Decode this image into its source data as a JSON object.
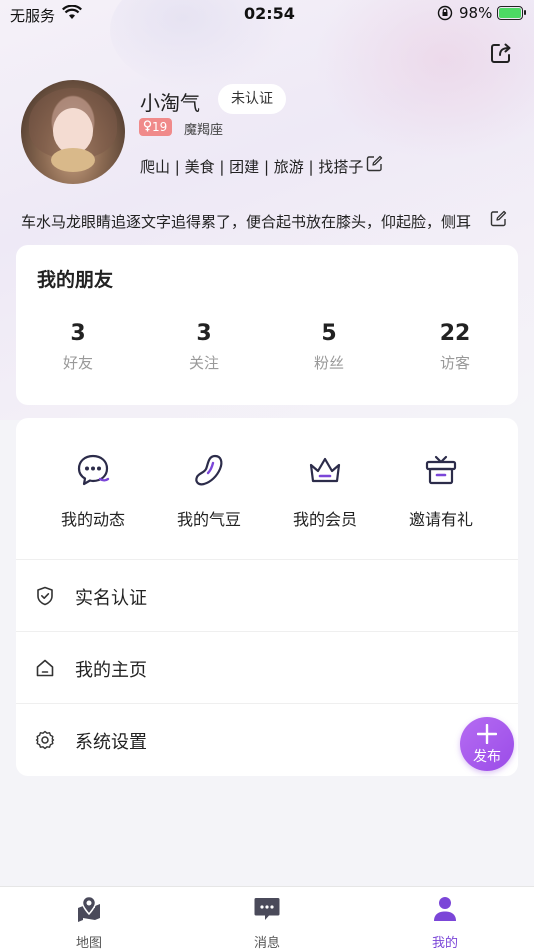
{
  "status_bar": {
    "carrier": "无服务",
    "time": "02:54",
    "battery": "98%"
  },
  "profile": {
    "nickname": "小淘气",
    "verify_status": "未认证",
    "age": "19",
    "zodiac": "魔羯座",
    "tags": "爬山 | 美食 | 团建 | 旅游 | 找搭子",
    "bio": "车水马龙眼睛追逐文字追得累了，便合起书放在膝头，仰起脸，侧耳"
  },
  "friends": {
    "title": "我的朋友",
    "stats": [
      {
        "value": "3",
        "label": "好友"
      },
      {
        "value": "3",
        "label": "关注"
      },
      {
        "value": "5",
        "label": "粉丝"
      },
      {
        "value": "22",
        "label": "访客"
      }
    ]
  },
  "features": [
    {
      "label": "我的动态",
      "icon": "chat-bubble-icon"
    },
    {
      "label": "我的气豆",
      "icon": "bean-icon"
    },
    {
      "label": "我的会员",
      "icon": "crown-icon"
    },
    {
      "label": "邀请有礼",
      "icon": "gift-icon"
    }
  ],
  "menu": [
    {
      "label": "实名认证",
      "icon": "shield-check-icon"
    },
    {
      "label": "我的主页",
      "icon": "home-icon"
    },
    {
      "label": "系统设置",
      "icon": "gear-icon"
    }
  ],
  "fab": {
    "label": "发布"
  },
  "tabs": [
    {
      "label": "地图",
      "icon": "map-pin-icon"
    },
    {
      "label": "消息",
      "icon": "message-icon"
    },
    {
      "label": "我的",
      "icon": "user-icon"
    }
  ],
  "colors": {
    "accent": "#7b46d8",
    "fab": "#a55cee",
    "age_badge": "#f08a8a",
    "icon_purple": "#6a3fcf"
  }
}
